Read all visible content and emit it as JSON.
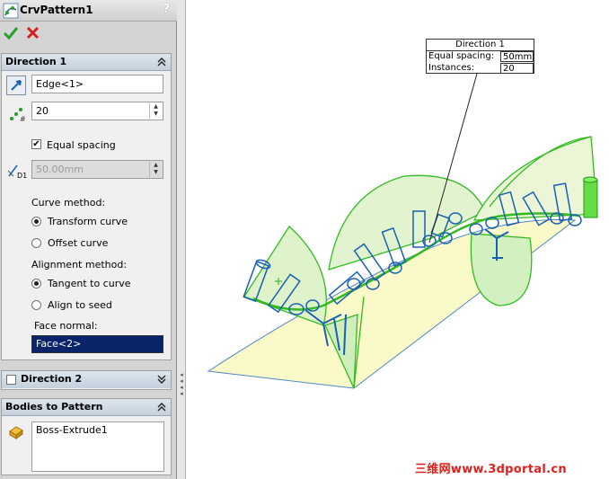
{
  "title": "CrvPattern1",
  "help": "?",
  "direction1": {
    "header": "Direction 1",
    "edge_value": "Edge<1>",
    "instances_value": "20",
    "equal_spacing_label": "Equal spacing",
    "spacing_value": "50.00mm",
    "curve_method_label": "Curve method:",
    "transform_curve": "Transform curve",
    "offset_curve": "Offset curve",
    "alignment_method_label": "Alignment method:",
    "tangent_to_curve": "Tangent to curve",
    "align_to_seed": "Align to seed",
    "face_normal_label": "Face normal:",
    "face_normal_value": "Face<2>",
    "d1_label": "D1"
  },
  "direction2": {
    "header": "Direction 2"
  },
  "bodies": {
    "header": "Bodies to Pattern",
    "item": "Boss-Extrude1"
  },
  "callout": {
    "title": "Direction 1",
    "spacing_label": "Equal spacing:",
    "spacing_value": "50mm",
    "instances_label": "Instances:",
    "instances_value": "20"
  },
  "watermark": "三维网www.3dportal.cn",
  "colors": {
    "header": "#c4d0dc",
    "face_value_bg": "#0a246a",
    "model_green": "#33bb22",
    "model_blue": "#1a5fb4",
    "surface_yellow": "#fafac8"
  }
}
